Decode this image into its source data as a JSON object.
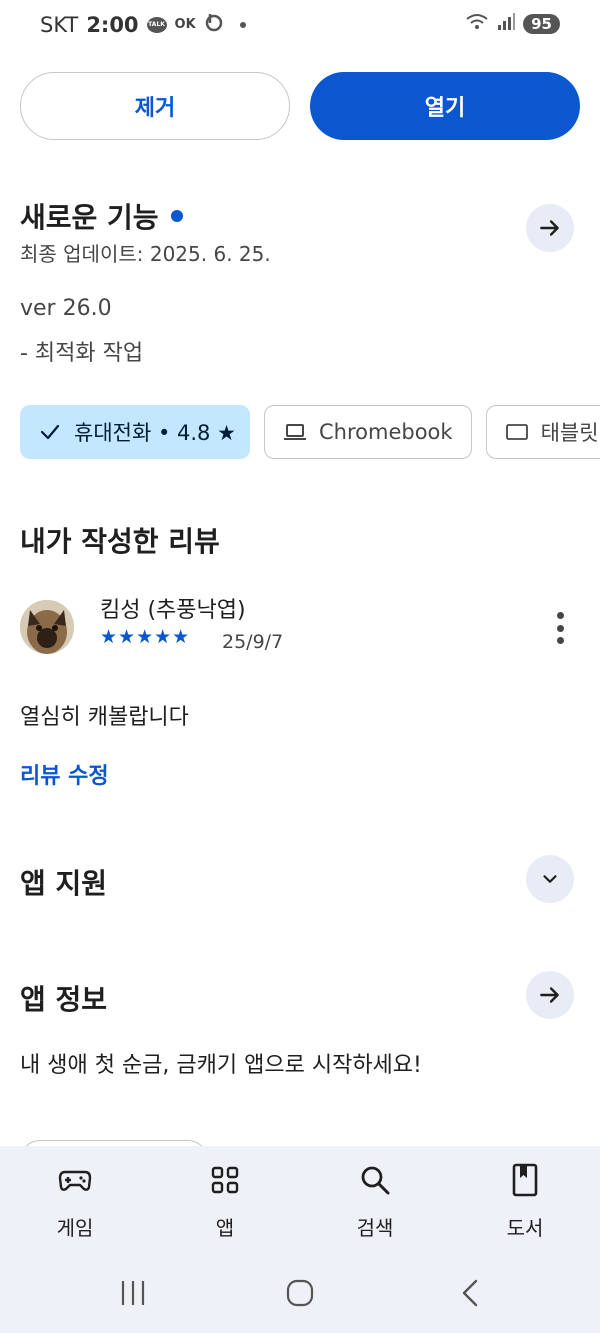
{
  "status_bar": {
    "carrier": "SKT",
    "time": "2:00",
    "talk_icon_text": "TALK",
    "ok_icon_text": "OK",
    "battery": "95",
    "icons": [
      "talk-icon",
      "ok-icon",
      "b-icon",
      "wifi-icon",
      "signal-icon"
    ]
  },
  "actions": {
    "remove_label": "제거",
    "open_label": "열기"
  },
  "whats_new": {
    "title": "새로운 기능",
    "updated": "최종 업데이트: 2025. 6. 25.",
    "version": "ver 26.0",
    "note": "- 최적화 작업"
  },
  "device_chips": [
    {
      "label": "휴대전화 • 4.8 ★",
      "icon": "check-icon",
      "selected": true
    },
    {
      "label": "Chromebook",
      "icon": "laptop-icon",
      "selected": false
    },
    {
      "label": "태블릿",
      "icon": "tablet-icon",
      "selected": false
    }
  ],
  "my_review": {
    "title": "내가 작성한 리뷰",
    "reviewer": "킴성 (추풍낙엽)",
    "stars": "★★★★★",
    "rating": 5,
    "date": "25/9/7",
    "text": "열심히 캐볼랍니다",
    "edit_label": "리뷰 수정"
  },
  "app_support": {
    "title": "앱 지원"
  },
  "app_info": {
    "title": "앱 정보",
    "description": "내 생애 첫 순금, 금캐기 앱으로 시작하세요!"
  },
  "bottom_nav": [
    {
      "label": "게임",
      "icon": "games-icon"
    },
    {
      "label": "앱",
      "icon": "apps-icon"
    },
    {
      "label": "검색",
      "icon": "search-icon"
    },
    {
      "label": "도서",
      "icon": "books-icon"
    }
  ],
  "colors": {
    "primary": "#0b57d0",
    "chip_selected_bg": "#c2e7ff",
    "nav_bg": "#eef1f8",
    "arrow_btn_bg": "#e8ecf6"
  }
}
